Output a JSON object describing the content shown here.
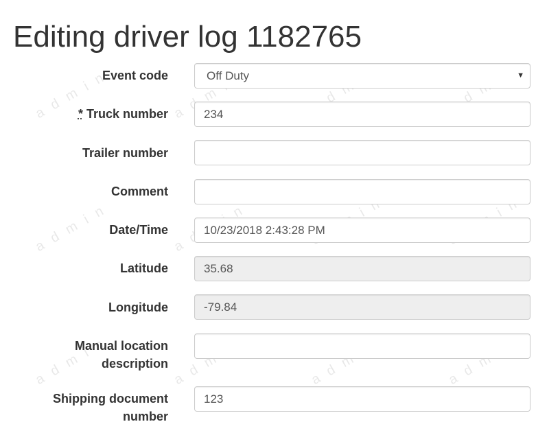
{
  "page": {
    "title": "Editing driver log 1182765",
    "watermark": "admin"
  },
  "form": {
    "event_code": {
      "label": "Event code",
      "value": "Off Duty"
    },
    "truck_number": {
      "required_marker": "*",
      "label": "Truck number",
      "value": "234"
    },
    "trailer_number": {
      "label": "Trailer number",
      "value": ""
    },
    "comment": {
      "label": "Comment",
      "value": ""
    },
    "date_time": {
      "label": "Date/Time",
      "value": "10/23/2018 2:43:28 PM"
    },
    "latitude": {
      "label": "Latitude",
      "value": "35.68"
    },
    "longitude": {
      "label": "Longitude",
      "value": "-79.84"
    },
    "manual_location": {
      "label_line1": "Manual location",
      "label_line2": "description",
      "value": ""
    },
    "shipping_document": {
      "label_line1": "Shipping document",
      "label_line2": "number",
      "value": "123"
    }
  },
  "icons": {
    "select_caret": "chevron-down-icon"
  }
}
